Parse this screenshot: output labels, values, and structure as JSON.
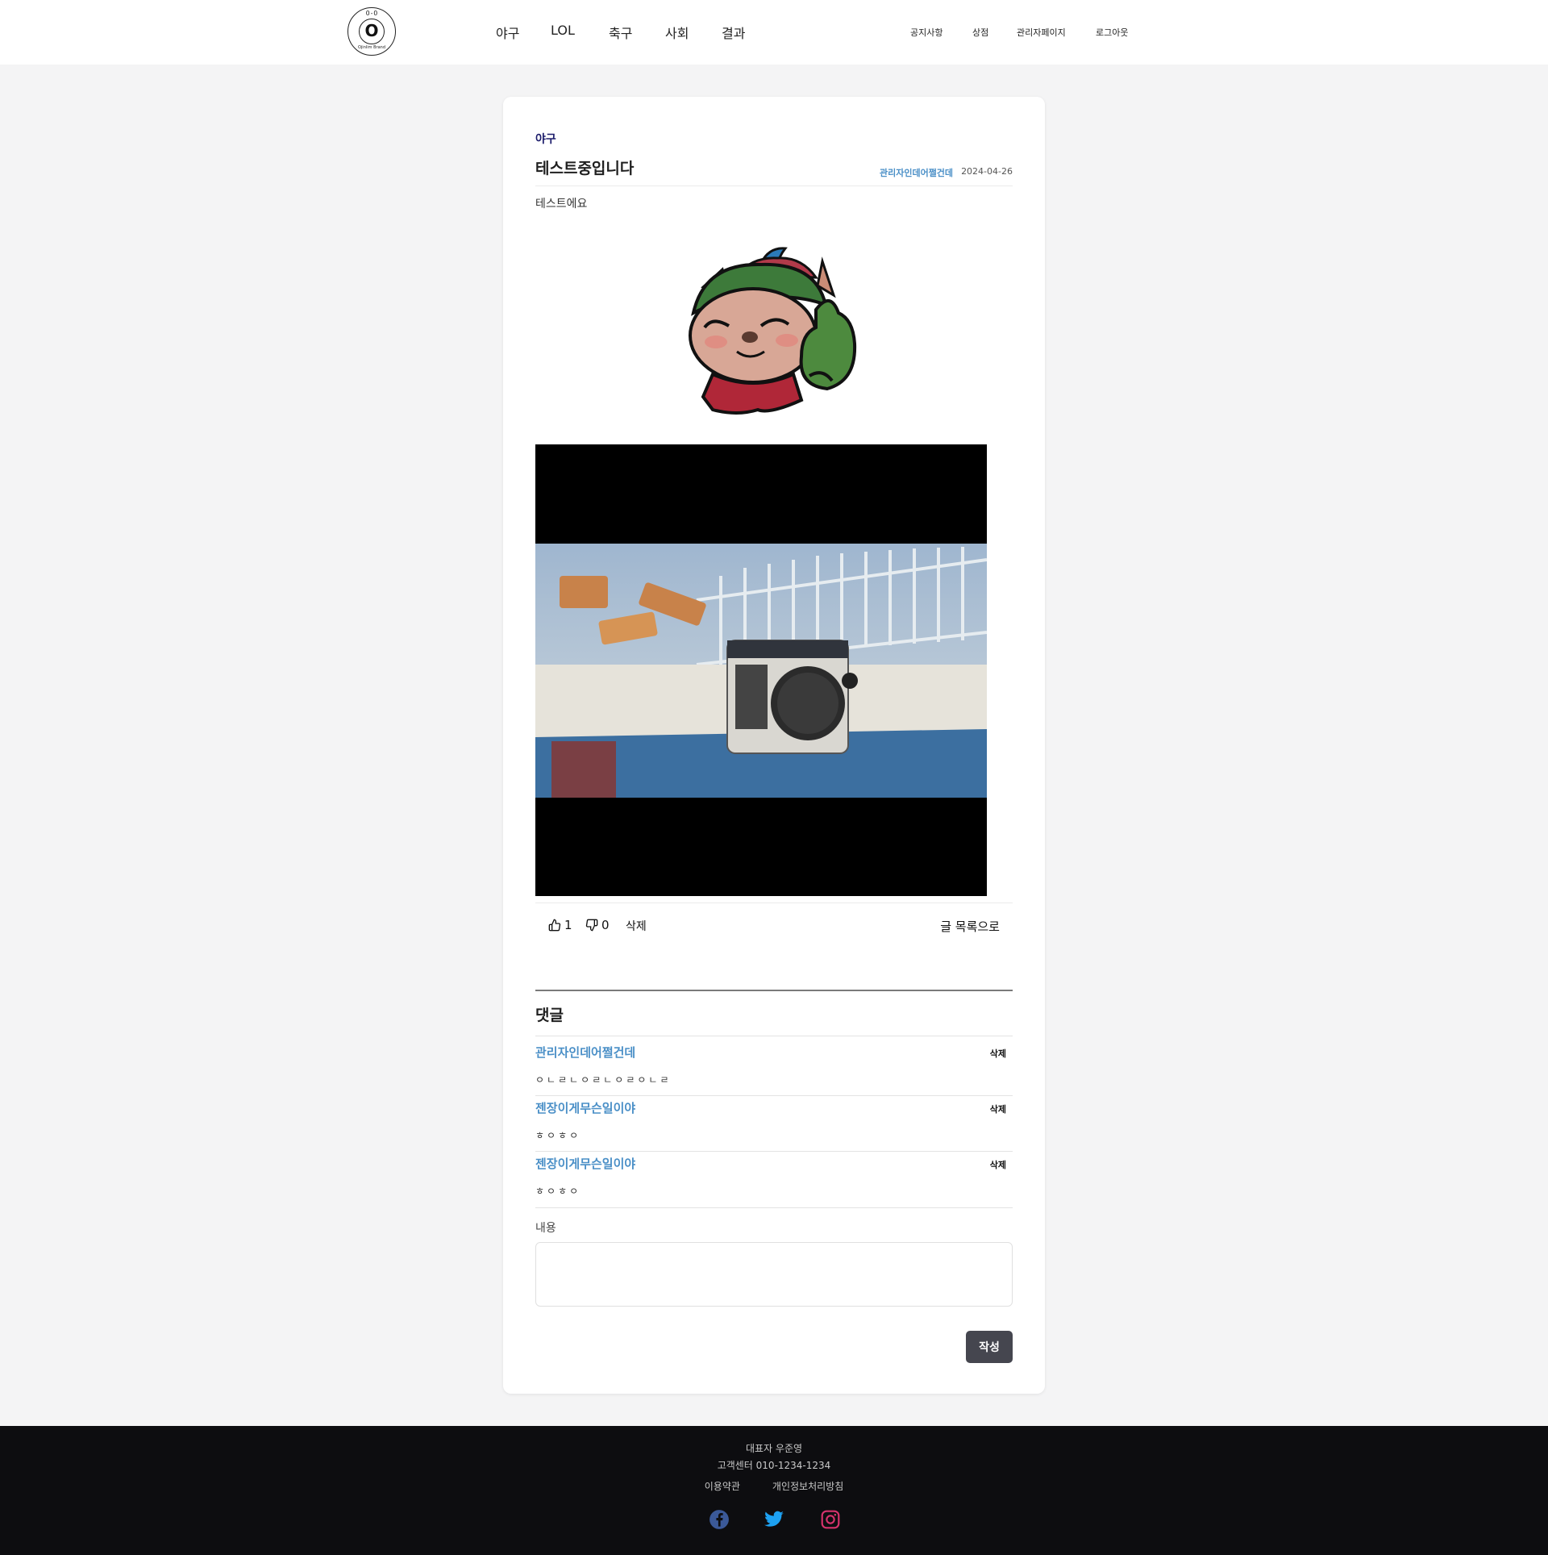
{
  "header": {
    "logo_top_mark": "O-O",
    "logo_letter": "O",
    "logo_bottom_mark": "Ojinlim Brand",
    "nav": [
      "야구",
      "LOL",
      "축구",
      "사회",
      "결과"
    ],
    "util": [
      "공지사항",
      "상점",
      "관리자페이지",
      "로그아웃"
    ]
  },
  "post": {
    "category": "야구",
    "title": "테스트중입니다",
    "author": "관리자인데어쩔건데",
    "date": "2024-04-26",
    "body": "테스트에요"
  },
  "actions": {
    "like_count": "1",
    "dislike_count": "0",
    "delete_label": "삭제",
    "back_label": "글 목록으로"
  },
  "comments": {
    "heading": "댓글",
    "items": [
      {
        "author": "관리자인데어쩔건데",
        "text": "ㅇㄴㄹㄴㅇㄹㄴㅇㄹㅇㄴㄹ",
        "delete_label": "삭제"
      },
      {
        "author": "젠장이게무슨일이야",
        "text": "ㅎㅇㅎㅇ",
        "delete_label": "삭제"
      },
      {
        "author": "젠장이게무슨일이야",
        "text": "ㅎㅇㅎㅇ",
        "delete_label": "삭제"
      }
    ]
  },
  "form": {
    "content_label": "내용",
    "content_value": "",
    "submit_label": "작성"
  },
  "footer": {
    "ceo": "대표자 우준영",
    "support": "고객센터 010-1234-1234",
    "links": [
      "이용약관",
      "개인정보처리방침"
    ],
    "social_icons": [
      "facebook-icon",
      "twitter-icon",
      "instagram-icon"
    ]
  },
  "colors": {
    "accent_blue": "#4a8fc7",
    "category_navy": "#1c1c6b",
    "footer_bg": "#0d0d10",
    "button_bg": "#45464f",
    "facebook": "#3b5998",
    "twitter": "#1da1f2",
    "instagram": "#d6336c"
  }
}
